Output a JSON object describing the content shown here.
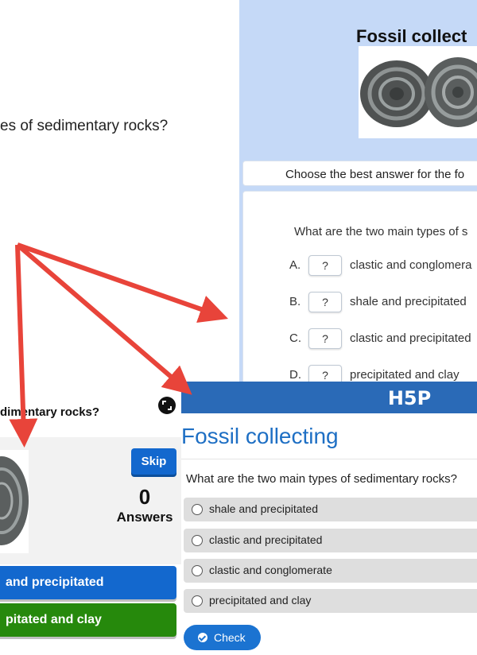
{
  "panel1": {
    "question_fragment": "es of sedimentary rocks?"
  },
  "panel2": {
    "title": "Fossil collect",
    "instruction": "Choose the best answer for the fo",
    "question": "What are the two main types of s",
    "options": [
      {
        "letter": "A.",
        "box": "?",
        "text": "clastic and conglomera"
      },
      {
        "letter": "B.",
        "box": "?",
        "text": "shale and precipitated"
      },
      {
        "letter": "C.",
        "box": "?",
        "text": "clastic and precipitated"
      },
      {
        "letter": "D.",
        "box": "?",
        "text": "precipitated and clay"
      }
    ],
    "background_color": "#c5d9f7"
  },
  "panel3": {
    "question_fragment": "dimentary rocks?",
    "skip_label": "Skip",
    "answers_count": "0",
    "answers_label": "Answers",
    "buttons": [
      {
        "text": "and precipitated",
        "color": "#1368ce"
      },
      {
        "text": "pitated and clay",
        "color": "#26890c"
      }
    ],
    "icons": {
      "expand": "expand-icon"
    }
  },
  "panel4": {
    "logo": "H5P",
    "title": "Fossil collecting",
    "question": "What are the two main types of sedimentary rocks?",
    "options": [
      "shale and precipitated",
      "clastic and precipitated",
      "clastic and conglomerate",
      "precipitated and clay"
    ],
    "check_label": "Check",
    "brand_color": "#2a6ab7"
  },
  "arrows": {
    "color": "#e8443a"
  }
}
